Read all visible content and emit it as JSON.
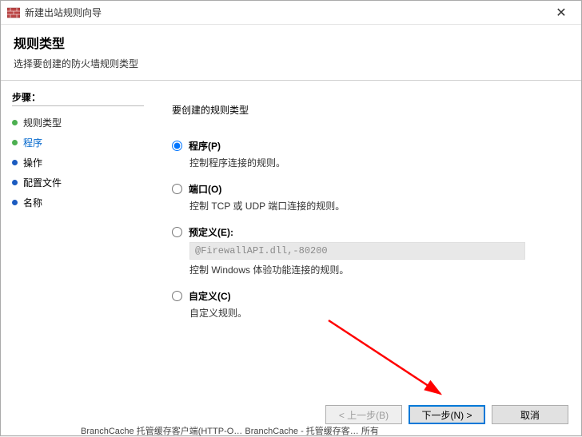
{
  "window": {
    "title": "新建出站规则向导",
    "close_glyph": "✕"
  },
  "header": {
    "title": "规则类型",
    "subtitle": "选择要创建的防火墙规则类型"
  },
  "steps": {
    "label": "步骤：",
    "items": [
      {
        "label": "规则类型",
        "state": "active"
      },
      {
        "label": "程序",
        "state": "link"
      },
      {
        "label": "操作",
        "state": "pending"
      },
      {
        "label": "配置文件",
        "state": "pending"
      },
      {
        "label": "名称",
        "state": "pending"
      }
    ]
  },
  "content": {
    "heading": "要创建的规则类型",
    "options": [
      {
        "id": "program",
        "label": "程序(P)",
        "desc": "控制程序连接的规则。",
        "checked": true
      },
      {
        "id": "port",
        "label": "端口(O)",
        "desc": "控制 TCP 或 UDP 端口连接的规则。",
        "checked": false
      },
      {
        "id": "predefined",
        "label": "预定义(E):",
        "desc": "控制 Windows 体验功能连接的规则。",
        "predef_text": "@FirewallAPI.dll,-80200",
        "checked": false
      },
      {
        "id": "custom",
        "label": "自定义(C)",
        "desc": "自定义规则。",
        "checked": false
      }
    ]
  },
  "buttons": {
    "back": "< 上一步(B)",
    "next": "下一步(N) >",
    "cancel": "取消"
  },
  "bottom_peek": "BranchCache 托管缓存客户端(HTTP-O…   BranchCache - 托管缓存客…   所有"
}
